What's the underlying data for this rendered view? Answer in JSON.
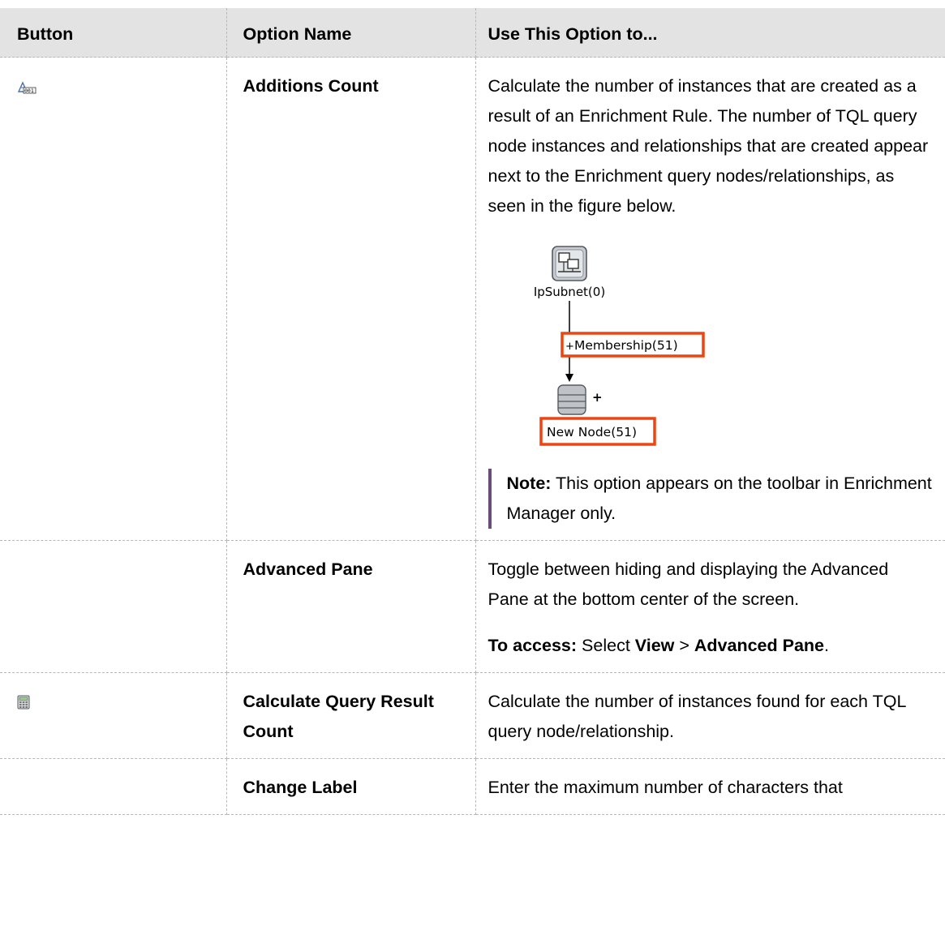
{
  "table": {
    "headers": [
      "Button",
      "Option Name",
      "Use This Option to..."
    ],
    "rows": [
      {
        "icon": "additions-count-icon",
        "name": "Additions Count",
        "description": "Calculate the number of instances that are created as a result of an Enrichment Rule. The number of TQL query node instances and relationships that are created appear next to the Enrichment query nodes/relationships, as seen in the figure below.",
        "figure": {
          "top_node_label": "IpSubnet(0)",
          "relationship_label": "Membership(51)",
          "bottom_node_label": "New Node(51)",
          "plus_sign": "+",
          "highlight_color": "#ee4411"
        },
        "note_label": "Note:",
        "note_text": " This option appears on the toolbar in Enrichment Manager only."
      },
      {
        "icon": "",
        "name": "Advanced Pane",
        "description": "Toggle between hiding and displaying the Advanced Pane at the bottom center of the screen.",
        "access_label": "To access:",
        "access_select": " Select ",
        "access_view": "View",
        "access_sep": " > ",
        "access_target": "Advanced Pane",
        "access_end": "."
      },
      {
        "icon": "calculator-icon",
        "name": "Calculate Query Result Count",
        "description": "Calculate the number of instances found for each TQL query node/relationship."
      },
      {
        "icon": "",
        "name": "Change Label",
        "description": "Enter the maximum number of characters that"
      }
    ]
  }
}
